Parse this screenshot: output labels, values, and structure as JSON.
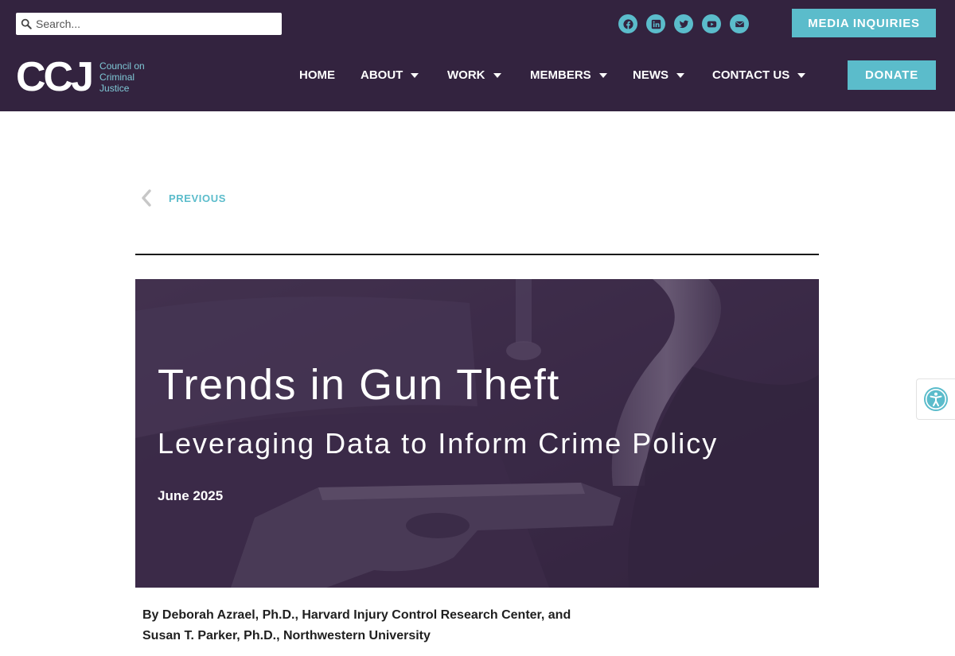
{
  "search": {
    "placeholder": "Search...",
    "value": ""
  },
  "socials": [
    {
      "icon": "facebook-icon"
    },
    {
      "icon": "linkedin-icon"
    },
    {
      "icon": "twitter-icon"
    },
    {
      "icon": "youtube-icon"
    },
    {
      "icon": "envelope-icon"
    }
  ],
  "buttons": {
    "media": "MEDIA INQUIRIES",
    "donate": "DONATE"
  },
  "logo": {
    "mark": "CCJ",
    "line1": "Council on",
    "line2": "Criminal",
    "line3": "Justice"
  },
  "nav": [
    {
      "label": "HOME",
      "dropdown": false
    },
    {
      "label": "ABOUT",
      "dropdown": true
    },
    {
      "label": "WORK",
      "dropdown": true
    },
    {
      "label": "MEMBERS",
      "dropdown": true
    },
    {
      "label": "NEWS",
      "dropdown": true
    },
    {
      "label": "CONTACT US",
      "dropdown": true
    }
  ],
  "previous": {
    "label": "PREVIOUS"
  },
  "hero": {
    "title": "Trends in Gun Theft",
    "subtitle": "Leveraging Data to Inform Crime Policy",
    "date": "June 2025"
  },
  "byline": {
    "line1": "By Deborah Azrael, Ph.D., Harvard Injury Control Research Center, and",
    "line2": "Susan T. Parker, Ph.D., Northwestern University"
  },
  "colors": {
    "header_bg": "#33233f",
    "accent": "#5bbccb",
    "hero_overlay": "#3a2746"
  }
}
